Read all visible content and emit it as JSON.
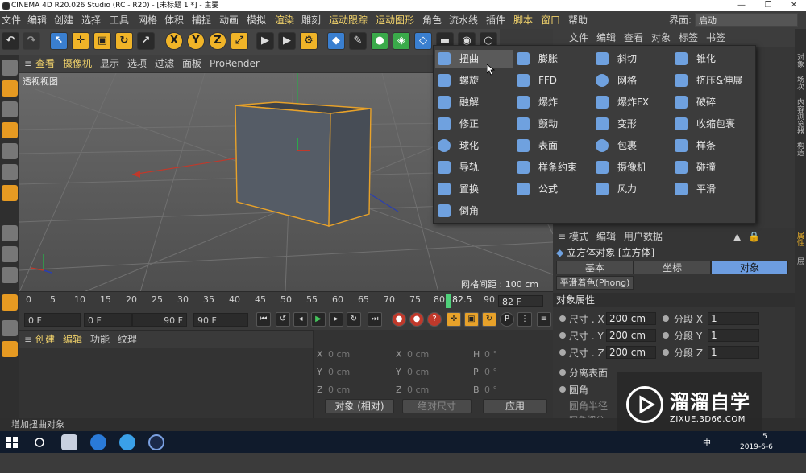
{
  "window": {
    "title": "CINEMA 4D R20.026 Studio (RC - R20) - [未标题 1 *] - 主要",
    "min_glyph": "—",
    "max_glyph": "❐",
    "close_glyph": "✕"
  },
  "menubar": {
    "items": [
      "文件",
      "编辑",
      "创建",
      "选择",
      "工具",
      "网格",
      "体积",
      "捕捉",
      "动画",
      "模拟",
      "渲染",
      "雕刻",
      "运动跟踪",
      "运动图形",
      "角色",
      "流水线",
      "插件",
      "脚本",
      "窗口",
      "帮助"
    ],
    "layout_label": "界面:",
    "layout_value": "启动"
  },
  "toolbar": {
    "x_label": "X",
    "y_label": "Y",
    "z_label": "Z"
  },
  "viewport": {
    "menu": [
      "查看",
      "摄像机",
      "显示",
      "选项",
      "过滤",
      "面板",
      "ProRender"
    ],
    "label": "透视视图",
    "grid_spacing": "网格间距 : 100 cm"
  },
  "timeline": {
    "ticks": [
      "0",
      "5",
      "10",
      "15",
      "20",
      "25",
      "30",
      "35",
      "40",
      "45",
      "50",
      "55",
      "60",
      "65",
      "70",
      "75",
      "80",
      "82.5",
      "90"
    ],
    "frame_value": "82 F"
  },
  "transport": {
    "start": "0 F",
    "range_start": "0 F",
    "range_end": "90 F",
    "end": "90 F"
  },
  "material_panel": {
    "menu": [
      "创建",
      "编辑",
      "功能",
      "纹理"
    ]
  },
  "coord_panel": {
    "rows": [
      {
        "a": "X",
        "av": "0 cm",
        "b": "X",
        "bv": "0 cm",
        "c": "H",
        "cv": "0 °"
      },
      {
        "a": "Y",
        "av": "0 cm",
        "b": "Y",
        "bv": "0 cm",
        "c": "P",
        "cv": "0 °"
      },
      {
        "a": "Z",
        "av": "0 cm",
        "b": "Z",
        "bv": "0 cm",
        "c": "B",
        "cv": "0 °"
      }
    ],
    "mode": "对象 (相对)",
    "size_mode": "绝对尺寸",
    "apply": "应用"
  },
  "object_manager": {
    "menu": [
      "文件",
      "编辑",
      "查看",
      "对象",
      "标签",
      "书签"
    ]
  },
  "deformer_menu": {
    "col1": [
      "扭曲",
      "螺旋",
      "融解",
      "修正",
      "球化",
      "导轨",
      "置换",
      "倒角"
    ],
    "col2": [
      "膨胀",
      "FFD",
      "爆炸",
      "颤动",
      "表面",
      "样条约束",
      "公式"
    ],
    "col3": [
      "斜切",
      "网格",
      "爆炸FX",
      "变形",
      "包裹",
      "摄像机",
      "风力"
    ],
    "col4": [
      "锥化",
      "挤压&伸展",
      "破碎",
      "收缩包裹",
      "样条",
      "碰撞",
      "平滑"
    ],
    "highlighted": "扭曲"
  },
  "attribute_manager": {
    "menu": [
      "模式",
      "编辑",
      "用户数据"
    ],
    "title": "立方体对象 [立方体]",
    "tabs": [
      "基本",
      "坐标",
      "对象"
    ],
    "active_tab": "对象",
    "phong_tab": "平滑着色(Phong)",
    "section": "对象属性",
    "size_x_label": "尺寸 . X",
    "size_x": "200 cm",
    "size_y_label": "尺寸 . Y",
    "size_y": "200 cm",
    "size_z_label": "尺寸 . Z",
    "size_z": "200 cm",
    "seg_x_label": "分段 X",
    "seg_x": "1",
    "seg_y_label": "分段 Y",
    "seg_y": "1",
    "seg_z_label": "分段 Z",
    "seg_z": "1",
    "separate_surfaces": "分离表面",
    "fillet": "圆角",
    "fillet_radius": "圆角半径",
    "fillet_subdiv": "圆角细分"
  },
  "right_tabs": [
    "对象",
    "场次",
    "内容浏览器",
    "构造",
    "属性",
    "层"
  ],
  "statusbar": {
    "text": "增加扭曲对象"
  },
  "watermark": {
    "title": "溜溜自学",
    "url": "ZIXUE.3D66.COM"
  },
  "taskbar": {
    "date": "2019-6-6",
    "time_partial": "5",
    "ime": "中"
  },
  "colors": {
    "accent_menu": "#f2d36b",
    "active_tab": "#6d9de0",
    "deformer_icon": "#6fa1df",
    "playhead": "#4fd07a"
  }
}
